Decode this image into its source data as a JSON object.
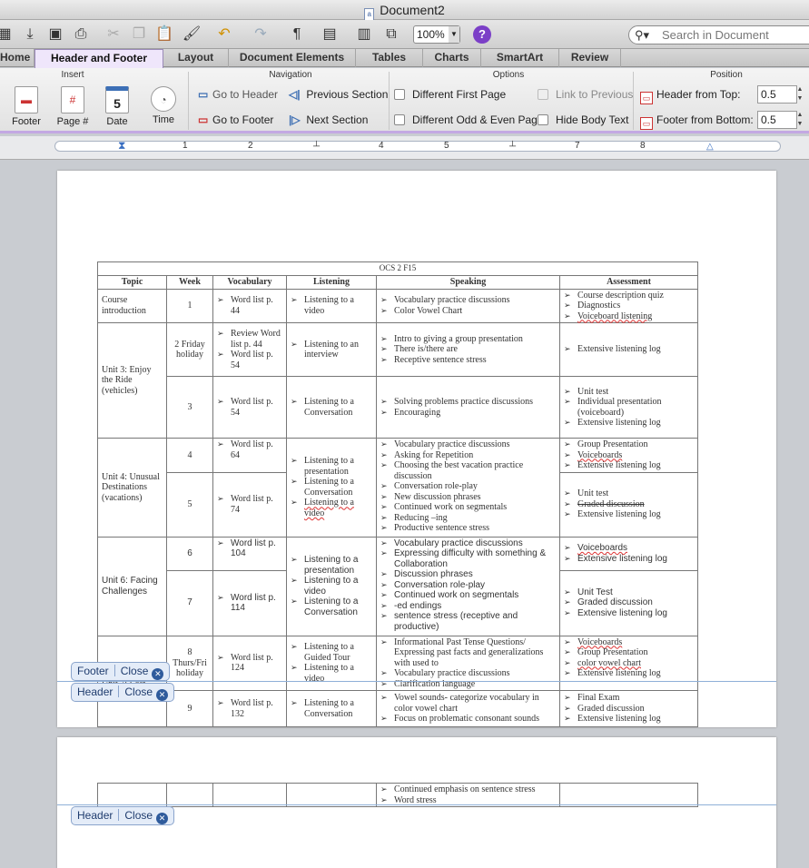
{
  "window": {
    "title": "Document2"
  },
  "toolbar": {
    "zoom": "100%",
    "search_placeholder": "Search in Document"
  },
  "tabs": [
    "Home",
    "Header and Footer",
    "Layout",
    "Document Elements",
    "Tables",
    "Charts",
    "SmartArt",
    "Review"
  ],
  "ribbon": {
    "groups": {
      "insert": "Insert",
      "navigation": "Navigation",
      "options": "Options",
      "position": "Position"
    },
    "insert": {
      "footer": "Footer",
      "page_num": "Page #",
      "date": "Date",
      "date_day": "5",
      "time": "Time"
    },
    "navigation": {
      "go_header": "Go to Header",
      "go_footer": "Go to Footer",
      "prev_section": "Previous Section",
      "next_section": "Next Section"
    },
    "options": {
      "diff_first": "Different First Page",
      "diff_odd_even": "Different Odd & Even Pages",
      "link_prev": "Link to Previous",
      "hide_body": "Hide Body Text"
    },
    "position": {
      "header_from_top": "Header from Top:",
      "header_value": "0.5",
      "footer_from_bottom": "Footer from Bottom:",
      "footer_value": "0.5"
    }
  },
  "ruler": {
    "numbers": [
      "1",
      "2",
      "3",
      "4",
      "5",
      "6",
      "7",
      "8"
    ]
  },
  "table": {
    "caption": "OCS 2 F15",
    "headers": [
      "Topic",
      "Week",
      "Vocabulary",
      "Listening",
      "Speaking",
      "Assessment"
    ],
    "r1": {
      "topic": "Course introduction",
      "week": "1",
      "vocab": "Word list p. 44",
      "listen": "Listening to a video",
      "speak": [
        "Vocabulary practice discussions",
        "Color Vowel Chart"
      ],
      "assess": [
        "Course description quiz",
        "Diagnostics",
        "Voiceboard listening"
      ]
    },
    "r2": {
      "topic": "Unit 3: Enjoy the Ride (vehicles)",
      "week": "2 Friday holiday",
      "vocab": [
        "Review Word list p. 44",
        "Word list p. 54"
      ],
      "listen": "Listening to an interview",
      "speak": [
        "Intro to giving a group presentation",
        "There is/there are",
        "Receptive sentence stress"
      ],
      "assess": [
        "Extensive listening log"
      ]
    },
    "r3": {
      "week": "3",
      "vocab": "Word list p. 54",
      "listen": "Listening to a Conversation",
      "speak": [
        "Solving problems practice discussions",
        "Encouraging"
      ],
      "assess": [
        "Unit test",
        "Individual presentation (voiceboard)",
        "Extensive listening log"
      ]
    },
    "r4": {
      "topic": "Unit 4: Unusual Destinations (vacations)",
      "week": "4",
      "vocab": "Word list p. 64",
      "listen": [
        "Listening to a presentation",
        "Listening to a Conversation",
        "Listening to a video"
      ],
      "speak": [
        "Vocabulary practice discussions",
        "Asking for Repetition",
        "Choosing the best vacation practice discussion",
        "Conversation role-play",
        "New discussion phrases",
        "Continued work on segmentals",
        "Reducing –ing",
        "Productive sentence stress"
      ],
      "assess": [
        "Group Presentation",
        "Voiceboards",
        "Extensive listening log"
      ]
    },
    "r5": {
      "week": "5",
      "vocab": "Word list p. 74",
      "assess": [
        "Unit test",
        "Graded discussion",
        "Extensive listening log"
      ]
    },
    "r6": {
      "topic": "Unit 6: Facing Challenges",
      "week": "6",
      "vocab": "Word list p. 104",
      "listen": [
        "Listening to a presentation",
        "Listening to a video",
        "Listening to a Conversation"
      ],
      "speak": [
        "Vocabulary practice discussions",
        "Expressing difficulty with something & Collaboration",
        "Discussion phrases",
        "Conversation role-play",
        "Continued work on segmentals",
        "-ed endings",
        "sentence stress (receptive and productive)"
      ],
      "assess": [
        "Voiceboards",
        "Extensive listening log"
      ]
    },
    "r7": {
      "week": "7",
      "vocab": "Word list p. 114",
      "assess": [
        "Unit Test",
        "Graded discussion",
        "Extensive listening log"
      ]
    },
    "r8": {
      "topic": "Unit 7: Lost",
      "week": "8 Thurs/Fri holiday",
      "vocab": "Word list p. 124",
      "listen": [
        "Listening to a Guided Tour",
        "Listening to a video"
      ],
      "speak": [
        "Informational Past Tense Questions/ Expressing past facts and generalizations with used to",
        "Vocabulary practice discussions",
        "Clarification language"
      ],
      "assess": [
        "Voiceboards",
        "Group Presentation",
        "color vowel chart",
        "Extensive listening log"
      ]
    },
    "r9": {
      "week": "9",
      "vocab": "Word list p. 132",
      "listen": "Listening to a Conversation",
      "speak": [
        "Vowel sounds- categorize vocabulary in color vowel chart",
        "Focus on problematic consonant sounds"
      ],
      "assess": [
        "Final Exam",
        "Graded discussion",
        "Extensive listening log"
      ]
    },
    "page2": {
      "speak": [
        "Continued emphasis on sentence stress",
        "Word stress"
      ]
    }
  },
  "hf": {
    "footer": "Footer",
    "header": "Header",
    "close": "Close"
  }
}
